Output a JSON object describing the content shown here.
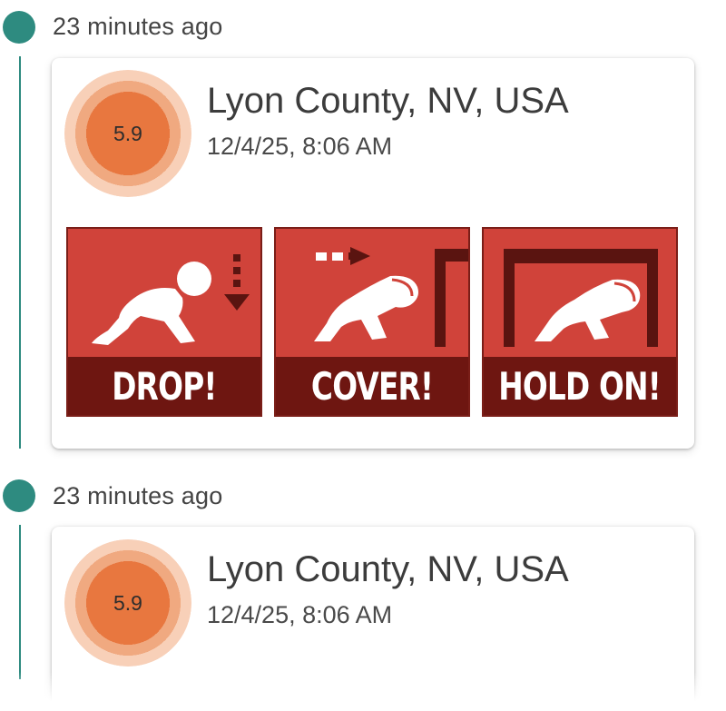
{
  "events": [
    {
      "time_ago": "23 minutes ago",
      "magnitude": "5.9",
      "location": "Lyon County, NV, USA",
      "datetime": "12/4/25, 8:06 AM",
      "image": {
        "panels": [
          {
            "caption": "DROP!",
            "icon": "drop-pose-icon"
          },
          {
            "caption": "COVER!",
            "icon": "cover-pose-icon"
          },
          {
            "caption": "HOLD ON!",
            "icon": "hold-on-pose-icon"
          }
        ]
      }
    },
    {
      "time_ago": "23 minutes ago",
      "magnitude": "5.9",
      "location": "Lyon County, NV, USA",
      "datetime": "12/4/25, 8:06 AM"
    }
  ],
  "colors": {
    "accent": "#2e8b80",
    "magnitude_fill": "#e8773f",
    "panel_red": "#d0433a",
    "panel_dark": "#6e1611"
  }
}
